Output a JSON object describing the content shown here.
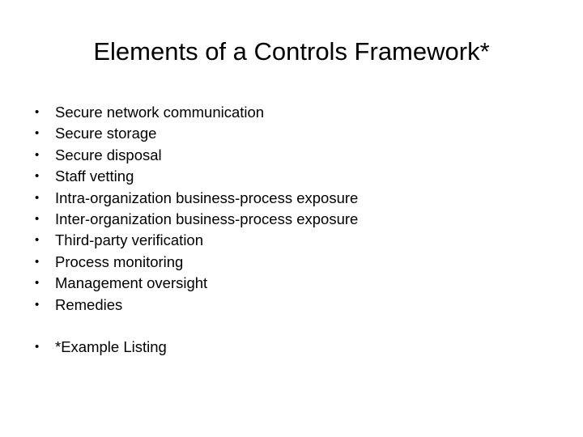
{
  "slide": {
    "background_color": "#ffffff",
    "text_color": "#000000",
    "title": "Elements of a Controls Framework*",
    "bullet_glyph": "•",
    "items": [
      {
        "label": "Secure network communication",
        "spacer_before": false
      },
      {
        "label": "Secure storage",
        "spacer_before": false
      },
      {
        "label": "Secure disposal",
        "spacer_before": false
      },
      {
        "label": "Staff vetting",
        "spacer_before": false
      },
      {
        "label": "Intra-organization business-process exposure",
        "spacer_before": false
      },
      {
        "label": "Inter-organization business-process exposure",
        "spacer_before": false
      },
      {
        "label": "Third-party verification",
        "spacer_before": false
      },
      {
        "label": "Process monitoring",
        "spacer_before": false
      },
      {
        "label": "Management oversight",
        "spacer_before": false
      },
      {
        "label": "Remedies",
        "spacer_before": false
      },
      {
        "label": "*Example Listing",
        "spacer_before": true
      }
    ]
  }
}
